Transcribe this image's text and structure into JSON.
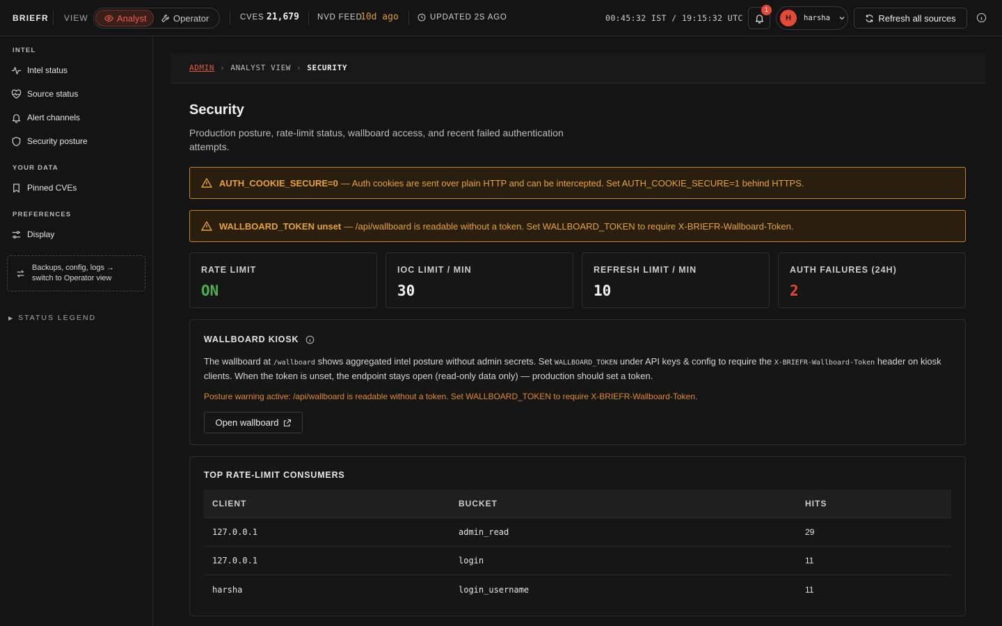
{
  "app": {
    "brand": "BRIEFR"
  },
  "topbar": {
    "view_label": "VIEW",
    "view_options": {
      "analyst": "Analyst",
      "operator": "Operator"
    },
    "cves_label": "CVES",
    "cves_value": "21,679",
    "nvd_label": "NVD FEED",
    "nvd_value": "10d ago",
    "updated": "UPDATED 2S AGO",
    "clock": "00:45:32 IST / 19:15:32 UTC",
    "notifications_count": "1",
    "user_initial": "H",
    "user_name": "harsha",
    "refresh_label": "Refresh all sources"
  },
  "sidebar": {
    "sections": [
      {
        "title": "INTEL",
        "items": [
          "Intel status",
          "Source status",
          "Alert channels",
          "Security posture"
        ]
      },
      {
        "title": "YOUR DATA",
        "items": [
          "Pinned CVEs"
        ]
      },
      {
        "title": "PREFERENCES",
        "items": [
          "Display"
        ]
      }
    ],
    "switch_line1": "Backups, config, logs →",
    "switch_line2": "switch to Operator view",
    "legend": "STATUS LEGEND"
  },
  "breadcrumb": {
    "admin": "ADMIN",
    "middle": "ANALYST VIEW",
    "current": "SECURITY"
  },
  "page": {
    "title": "Security",
    "description": "Production posture, rate-limit status, wallboard access, and recent failed authentication attempts."
  },
  "warnings": [
    {
      "key": "AUTH_COOKIE_SECURE=0",
      "text": "— Auth cookies are sent over plain HTTP and can be intercepted. Set AUTH_COOKIE_SECURE=1 behind HTTPS."
    },
    {
      "key": "WALLBOARD_TOKEN unset",
      "text": "— /api/wallboard is readable without a token. Set WALLBOARD_TOKEN to require X-BRIEFR-Wallboard-Token."
    }
  ],
  "stats": [
    {
      "label": "RATE LIMIT",
      "value": "ON",
      "color": "#4caf50"
    },
    {
      "label": "IOC LIMIT / MIN",
      "value": "30",
      "color": "#f2f2f2"
    },
    {
      "label": "REFRESH LIMIT / MIN",
      "value": "10",
      "color": "#f2f2f2"
    },
    {
      "label": "AUTH FAILURES (24H)",
      "value": "2",
      "color": "#e8483a"
    }
  ],
  "kiosk": {
    "title": "WALLBOARD KIOSK",
    "t1": "The wallboard at ",
    "c1": "/wallboard",
    "t2": " shows aggregated intel posture without admin secrets. Set ",
    "c2": "WALLBOARD_TOKEN",
    "t3": " under API keys & config to require the ",
    "c3": "X-BRIEFR-Wallboard-Token",
    "t4": " header on kiosk clients. When the token is unset, the endpoint stays open (read-only data only) — production should set a token.",
    "warning": "Posture warning active: /api/wallboard is readable without a token. Set WALLBOARD_TOKEN to require X-BRIEFR-Wallboard-Token.",
    "button": "Open wallboard"
  },
  "consumers": {
    "title": "TOP RATE-LIMIT CONSUMERS",
    "headers": {
      "client": "CLIENT",
      "bucket": "BUCKET",
      "hits": "HITS"
    },
    "rows": [
      {
        "client": "127.0.0.1",
        "bucket": "admin_read",
        "hits": "29"
      },
      {
        "client": "127.0.0.1",
        "bucket": "login",
        "hits": "11"
      },
      {
        "client": "harsha",
        "bucket": "login_username",
        "hits": "11"
      }
    ]
  },
  "colors": {
    "accent": "#e9573f",
    "warning": "#e8a233",
    "ok": "#4caf50",
    "danger": "#e8483a"
  }
}
